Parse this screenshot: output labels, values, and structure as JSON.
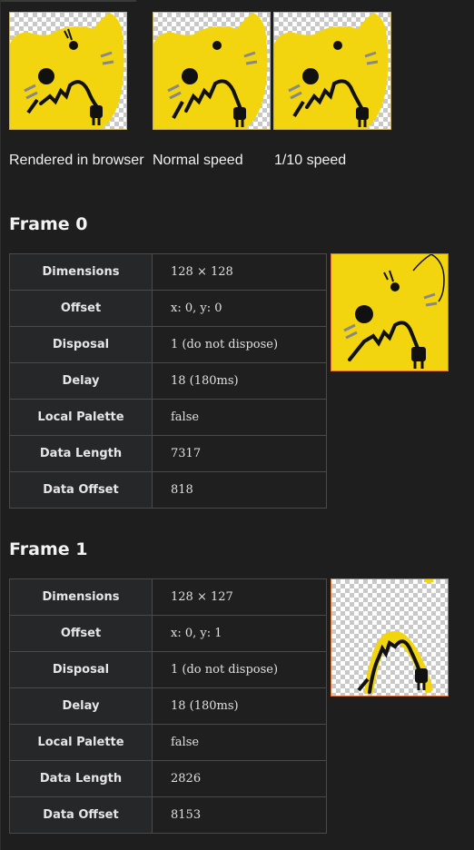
{
  "captions": {
    "rendered": "Rendered in browser",
    "normal": "Normal speed",
    "slow": "1/10 speed"
  },
  "frames": [
    {
      "title": "Frame 0",
      "rows": [
        {
          "label": "Dimensions",
          "value": "128 × 128"
        },
        {
          "label": "Offset",
          "value": "x: 0, y: 0"
        },
        {
          "label": "Disposal",
          "value": "1 (do not dispose)"
        },
        {
          "label": "Delay",
          "value": "18 (180ms)"
        },
        {
          "label": "Local Palette",
          "value": "false"
        },
        {
          "label": "Data Length",
          "value": "7317"
        },
        {
          "label": "Data Offset",
          "value": "818"
        }
      ]
    },
    {
      "title": "Frame 1",
      "rows": [
        {
          "label": "Dimensions",
          "value": "128 × 127"
        },
        {
          "label": "Offset",
          "value": "x: 0, y: 1"
        },
        {
          "label": "Disposal",
          "value": "1 (do not dispose)"
        },
        {
          "label": "Delay",
          "value": "18 (180ms)"
        },
        {
          "label": "Local Palette",
          "value": "false"
        },
        {
          "label": "Data Length",
          "value": "2826"
        },
        {
          "label": "Data Offset",
          "value": "8153"
        }
      ]
    }
  ],
  "colors": {
    "cat_yellow": "#f2d50f",
    "background": "#1e1e1e",
    "frame_border": "#e0743a"
  },
  "icons": {
    "cat": "cat-eating-cable-icon"
  }
}
